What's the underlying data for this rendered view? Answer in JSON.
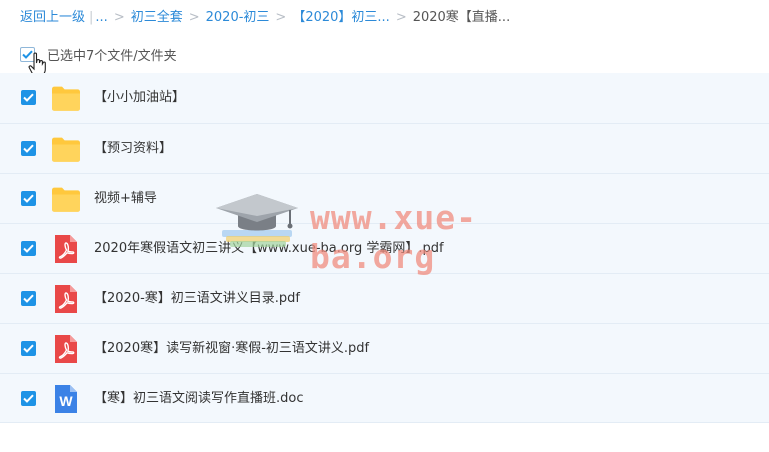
{
  "breadcrumb": {
    "back": "返回上一级",
    "ellipsis": "...",
    "sep": ">",
    "items": [
      "初三全套",
      "2020-初三",
      "【2020】初三..."
    ],
    "current": "2020寒【直播..."
  },
  "selection": {
    "label": "已选中7个文件/文件夹"
  },
  "files": [
    {
      "name": "【小小加油站】",
      "type": "folder-icon"
    },
    {
      "name": "【预习资料】",
      "type": "folder-icon"
    },
    {
      "name": "视频+辅导",
      "type": "folder-icon"
    },
    {
      "name": "2020年寒假语文初三讲义【www.xue-ba.org 学霸网】.pdf",
      "type": "pdf-icon"
    },
    {
      "name": "【2020-寒】初三语文讲义目录.pdf",
      "type": "pdf-icon"
    },
    {
      "name": "【2020寒】读写新视窗·寒假-初三语文讲义.pdf",
      "type": "pdf-icon"
    },
    {
      "name": "【寒】初三语文阅读写作直播班.doc",
      "type": "word-icon"
    }
  ],
  "watermark": {
    "text": "www.xue-ba.org"
  },
  "colors": {
    "accent": "#1e93e6",
    "link": "#2c8ad8",
    "row_bg": "#f3f8fd",
    "folder": "#ffc83d",
    "pdf": "#e94848",
    "word": "#3b82e6"
  }
}
